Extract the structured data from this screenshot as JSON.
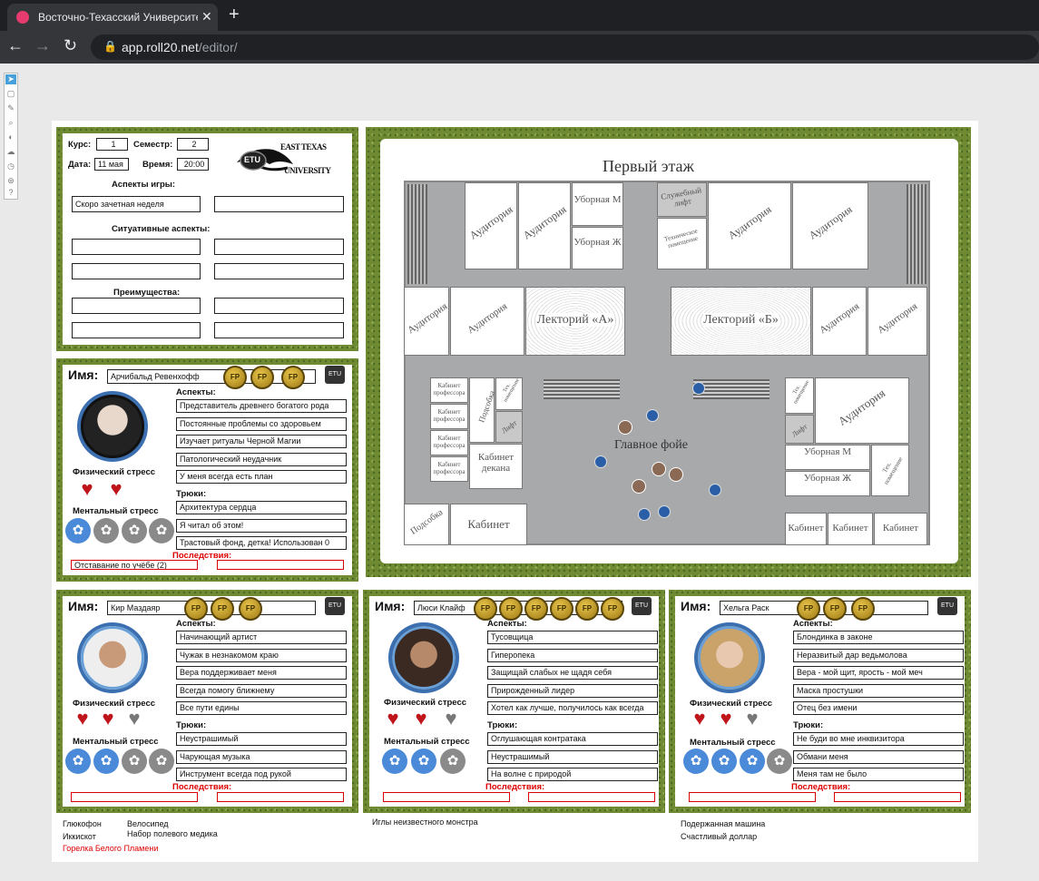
{
  "browser": {
    "tab_title": "Восточно-Техасский Университет",
    "url_domain": "app.roll20.net",
    "url_path": "/editor/"
  },
  "game_card": {
    "course_label": "Курс:",
    "course_value": "1",
    "semester_label": "Семестр:",
    "semester_value": "2",
    "date_label": "Дата:",
    "date_value": "11 мая",
    "time_label": "Время:",
    "time_value": "20:00",
    "logo_text_1": "EAST TEXAS",
    "logo_text_2": "UNIVERSITY",
    "logo_badge": "ETU",
    "game_aspects_label": "Аспекты игры:",
    "game_aspect_1": "Скоро зачетная неделя",
    "situational_label": "Ситуативные аспекты:",
    "advantages_label": "Преимущества:"
  },
  "sheet_labels": {
    "name": "Имя:",
    "aspects": "Аспекты:",
    "physical": "Физический стресс",
    "mental": "Ментальный стресс",
    "stunts": "Трюки:",
    "consequences": "Последствия:",
    "coin": "FP",
    "mini_logo": "ETU"
  },
  "characters": [
    {
      "name": "Арчибальд Ревенхофф",
      "aspects": [
        "Представитель древнего богатого рода",
        "Постоянные проблемы со здоровьем",
        "Изучает ритуалы Черной Магии",
        "Патологический неудачник",
        "У меня всегда есть план"
      ],
      "stunts": [
        "Архитектура сердца",
        "Я читал об этом!",
        "Трастовый фонд, детка! Использован 0"
      ],
      "consequence_1": "Отставание по учёбе (2)",
      "fate_points": 3
    },
    {
      "name": "Кир Маздаяр",
      "aspects": [
        "Начинающий артист",
        "Чужак в незнакомом краю",
        "Вера поддерживает меня",
        "Всегда помогу ближнему",
        "Все пути едины"
      ],
      "stunts": [
        "Неустрашимый",
        "Чарующая музыка",
        "Инструмент всегда под рукой"
      ],
      "fate_points": 3
    },
    {
      "name": "Люси Клайф",
      "aspects": [
        "Тусовщица",
        "Гиперопека",
        "Защищай слабых не щадя себя",
        "Прирожденный лидер",
        "Хотел как лучше, получилось как всегда"
      ],
      "stunts": [
        "Оглушающая контратака",
        "Неустрашимый",
        "На волне с природой"
      ],
      "fate_points": 6
    },
    {
      "name": "Хельга Раск",
      "aspects": [
        "Блондинка в законе",
        "Неразвитый дар ведьмолова",
        "Вера - мой щит, ярость - мой меч",
        "Маска простушки",
        "Отец без имени"
      ],
      "stunts": [
        "Не буди во мне инквизитора",
        "Обмани меня",
        "Меня там не было"
      ],
      "fate_points": 3
    }
  ],
  "items": {
    "col1": [
      "Глюкофон",
      "Иккискот"
    ],
    "col1_red": "Горелка Белого Пламени",
    "col2": [
      "Велосипед",
      "Набор полевого медика"
    ],
    "col3": "Иглы неизвестного монстра",
    "col4": [
      "Подержанная машина",
      "Счастливый доллар"
    ]
  },
  "map": {
    "title": "Первый этаж",
    "auditorium": "Аудитория",
    "toilet_m": "Уборная М",
    "toilet_f": "Уборная Ж",
    "service_lift": "Служебный лифт",
    "tech_room": "Техническое помещение",
    "tech_short": "Тех. помещение",
    "lecture_a": "Лекторий «А»",
    "lecture_b": "Лекторий «Б»",
    "prof_office": "Кабинет профессора",
    "pantry": "Подсобка",
    "lift": "Лифт",
    "dean": "Кабинет декана",
    "office": "Кабинет",
    "foyer": "Главное фойе"
  },
  "colors": {
    "accent": "#3b6fb0",
    "consequence": "#dd0000",
    "grass": "#6f8a33",
    "brain_on": "#4a8ad8",
    "brain_off": "#8a8a8a",
    "heart_on": "#c0141b",
    "heart_off": "#777777"
  }
}
